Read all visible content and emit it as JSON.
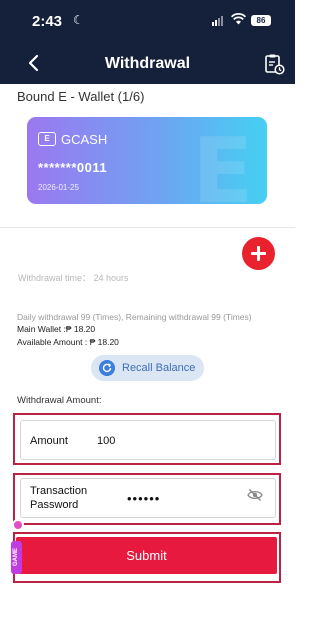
{
  "status_bar": {
    "time": "2:43",
    "battery": "86"
  },
  "nav": {
    "title": "Withdrawal"
  },
  "wallet": {
    "bound_label": "Bound E - Wallet (1/6)",
    "provider": "GCASH",
    "card_number": "*******0011",
    "expiry": "2026-01-25",
    "logo_letters": "E"
  },
  "info": {
    "withdrawal_time": "Withdrawal time： 24 hours",
    "daily_limit": "Daily withdrawal 99 (Times), Remaining withdrawal 99 (Times)",
    "main_wallet": "Main Wallet :₱ 18.20",
    "available_amount": "Available Amount : ₱ 18.20"
  },
  "recall_button": {
    "label": "Recall Balance"
  },
  "form": {
    "amount_section_label": "Withdrawal Amount:",
    "amount_label": "Amount",
    "amount_value": "100",
    "password_label_line1": "Transaction",
    "password_label_line2": "Password",
    "password_value": "••••••"
  },
  "submit_button": {
    "label": "Submit"
  },
  "game_tab": {
    "label": "GAME"
  },
  "colors": {
    "header_bg": "#15213a",
    "accent_red": "#e8193e",
    "highlight_border": "#bb2345",
    "recall_bg": "#dbe6f5",
    "game_purple": "#c13ce0"
  },
  "icons": {
    "back": "chevron-left-icon",
    "record": "clipboard-clock-icon",
    "add": "plus-icon",
    "recall": "refresh-icon",
    "eye": "eye-slash-icon"
  }
}
